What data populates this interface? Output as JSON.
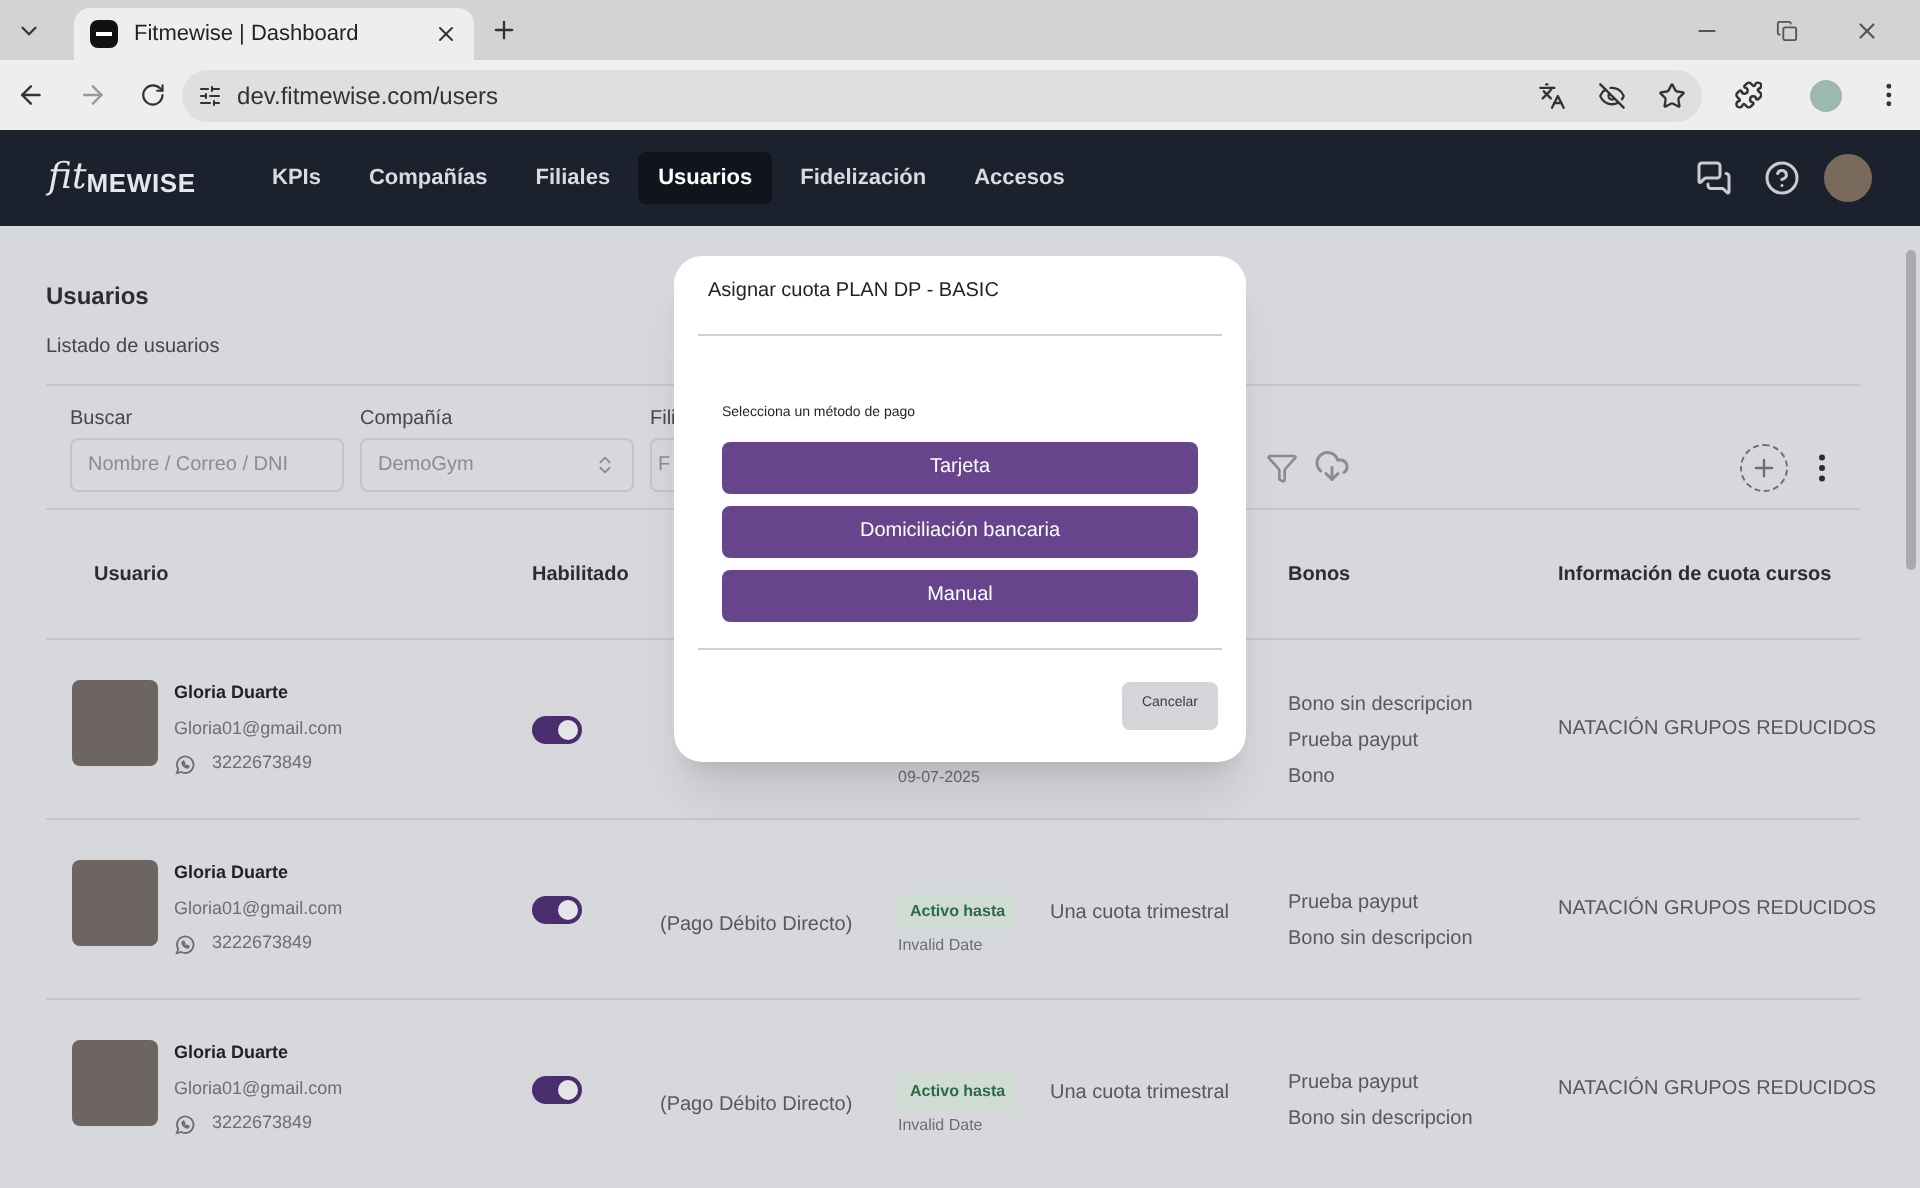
{
  "browser": {
    "tab_title": "Fitmewise | Dashboard",
    "url": "dev.fitmewise.com/users"
  },
  "nav": {
    "logo_script": "fit",
    "logo_text": "MEWISE",
    "items": [
      {
        "label": "KPIs",
        "selected": false
      },
      {
        "label": "Compañías",
        "selected": false
      },
      {
        "label": "Filiales",
        "selected": false
      },
      {
        "label": "Usuarios",
        "selected": true
      },
      {
        "label": "Fidelización",
        "selected": false
      },
      {
        "label": "Accesos",
        "selected": false
      }
    ]
  },
  "page": {
    "title": "Usuarios",
    "subtitle": "Listado de usuarios"
  },
  "filters": [
    {
      "kind": "text",
      "label": "Buscar",
      "placeholder": "Nombre / Correo / DNI"
    },
    {
      "kind": "select",
      "label": "Compañía",
      "value": "DemoGym"
    },
    {
      "kind": "text",
      "label": "Fili",
      "placeholder": "F"
    }
  ],
  "table": {
    "columns": [
      {
        "label": "Usuario"
      },
      {
        "label": "Habilitado"
      },
      {
        "label": "Bonos"
      },
      {
        "label": "Información de cuota cursos"
      }
    ],
    "rows": [
      {
        "name": "Gloria Duarte",
        "email": "Gloria01@gmail.com",
        "phone": "3222673849",
        "enabled": true,
        "status": {
          "date": "09-07-2025"
        },
        "bonos": [
          "Bono sin descripcion",
          "Prueba payput",
          "Bono"
        ],
        "courses": "NATACIÓN GRUPOS REDUCIDOS"
      },
      {
        "name": "Gloria Duarte",
        "email": "Gloria01@gmail.com",
        "phone": "3222673849",
        "enabled": true,
        "payment": "(Pago Débito Directo)",
        "status": {
          "badge": "Activo hasta",
          "date": "Invalid Date"
        },
        "fee": "Una cuota trimestral",
        "bonos": [
          "Prueba payput",
          "Bono sin descripcion"
        ],
        "courses": "NATACIÓN GRUPOS REDUCIDOS"
      },
      {
        "name": "Gloria Duarte",
        "email": "Gloria01@gmail.com",
        "phone": "3222673849",
        "enabled": true,
        "payment": "(Pago Débito Directo)",
        "status": {
          "badge": "Activo hasta",
          "date": "Invalid Date"
        },
        "fee": "Una cuota trimestral",
        "bonos": [
          "Prueba payput",
          "Bono sin descripcion"
        ],
        "courses": "NATACIÓN GRUPOS REDUCIDOS"
      }
    ]
  },
  "modal": {
    "title": "Asignar cuota PLAN DP - BASIC",
    "prompt": "Selecciona un método de pago",
    "options": [
      "Tarjeta",
      "Domiciliación bancaria",
      "Manual"
    ],
    "cancel": "Cancelar"
  }
}
